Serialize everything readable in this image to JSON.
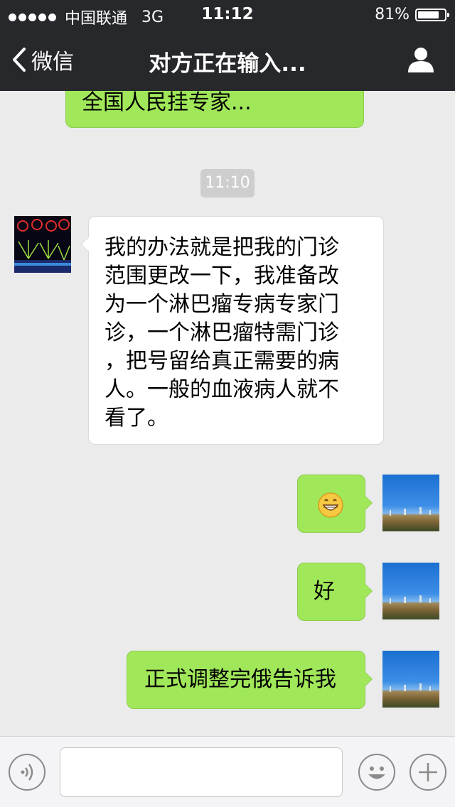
{
  "status_bar": {
    "carrier": "中国联通",
    "network": "3G",
    "time": "11:12",
    "battery_percent": "81%",
    "battery_level": 0.81,
    "signal_bars": 5
  },
  "nav": {
    "back_label": "微信",
    "title": "对方正在输入...",
    "back_icon": "chevron-left-icon",
    "profile_icon": "person-icon"
  },
  "messages": [
    {
      "side": "right",
      "text": "全国人民挂专家..."
    },
    {
      "side": "left",
      "text": "我的办法就是把我的门诊范围更改一下，我准备改为一个淋巴瘤专病专家门诊，一个淋巴瘤特需门诊，把号留给真正需要的病人。一般的血液病人就不看了。"
    },
    {
      "side": "right",
      "emoji": "grinning-face-emoji"
    },
    {
      "side": "right",
      "text": "好"
    },
    {
      "side": "right",
      "text": "正式调整完俄告诉我"
    }
  ],
  "timestamp": "11:10",
  "message_lines": {
    "m2": [
      "我的办法就是把我的门诊",
      "范围更改一下，我准备改",
      "为一个淋巴瘤专病专家门",
      "诊，一个淋巴瘤特需门诊",
      "，把号留给真正需要的病",
      "人。一般的血液病人就不",
      "看了。"
    ]
  },
  "input_bar": {
    "voice_icon": "voice-icon",
    "emoji_icon": "emoji-icon",
    "add_icon": "plus-icon",
    "input_value": ""
  },
  "colors": {
    "header_bg": "#27282c",
    "chat_bg": "#ebebeb",
    "sent_bubble": "#a0e75a",
    "received_bubble": "#ffffff"
  }
}
